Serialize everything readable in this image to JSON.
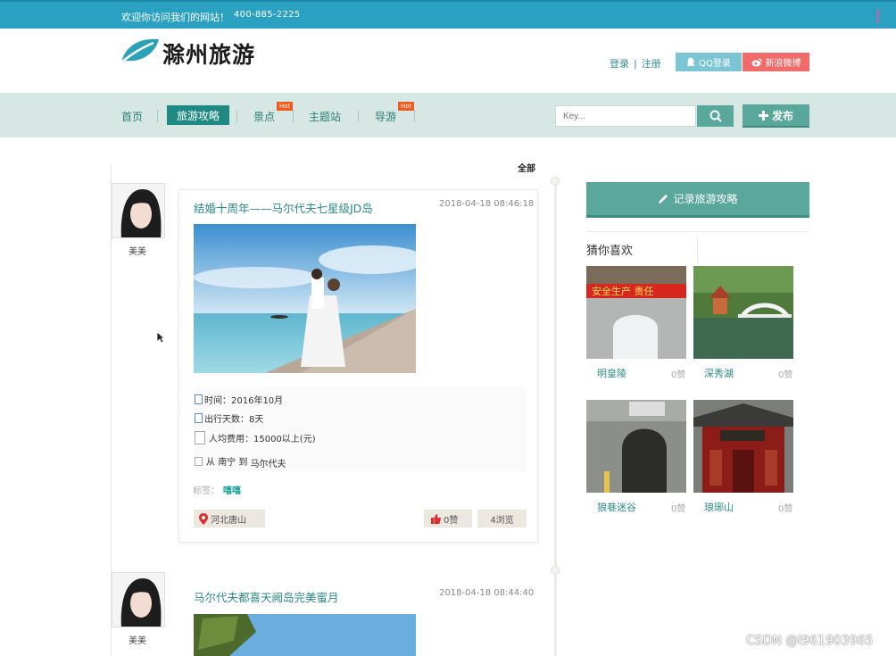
{
  "topbar": {
    "welcome": "欢迎你访问我们的网站！",
    "phone": "400-885-2225",
    "marquee": "| w"
  },
  "header": {
    "logo_text": "滁州旅游",
    "login": "登录",
    "separator": "|",
    "register": "注册",
    "qq_login": "QQ登录",
    "weibo_login": "新浪微博"
  },
  "nav": {
    "items": [
      {
        "label": "首页",
        "active": false,
        "hot": false
      },
      {
        "label": "旅游攻略",
        "active": true,
        "hot": false
      },
      {
        "label": "景点",
        "active": false,
        "hot": true
      },
      {
        "label": "主题站",
        "active": false,
        "hot": false
      },
      {
        "label": "导游",
        "active": false,
        "hot": true
      }
    ],
    "hot_label": "Hot",
    "search_placeholder": "Key...",
    "publish": "发布"
  },
  "feed": {
    "filter": "全部",
    "posts": [
      {
        "author": "美美",
        "title": "结婚十周年——马尔代夫七星级JD岛",
        "time": "2018-04-18 08:46:18",
        "info": {
          "time": "时间：2016年10月",
          "days": "出行天数：8天",
          "cost": "人均费用：15000以上(元)",
          "route_from_prefix": "从",
          "route_from": "南宁",
          "route_to_prefix": "到",
          "route_to": "马尔代夫"
        },
        "tags_label": "标签：",
        "tag": "嘻嘻",
        "location": "河北唐山",
        "likes": "0赞",
        "views": "4浏览"
      },
      {
        "author": "美美",
        "title": "马尔代夫都喜天阙岛完美蜜月",
        "time": "2018-04-18 08:44:40"
      }
    ]
  },
  "sidebar": {
    "record_button": "记录旅游攻略",
    "guess_title": "猜你喜欢",
    "items": [
      {
        "name": "明皇陵",
        "likes": "0赞"
      },
      {
        "name": "深秀湖",
        "likes": "0赞"
      },
      {
        "name": "狼巷迷谷",
        "likes": "0赞"
      },
      {
        "name": "琅琊山",
        "likes": "0赞"
      }
    ]
  },
  "watermark": "CSDN @l961903965",
  "colors": {
    "topbar": "#2aa1c0",
    "nav_bg": "#d7e7e3",
    "accent": "#5aa89b",
    "active_nav": "#1f8a84",
    "link": "#2a8b86",
    "weibo": "#f16b6b",
    "qq": "#7cc5d5",
    "hot": "#f05a1e"
  }
}
